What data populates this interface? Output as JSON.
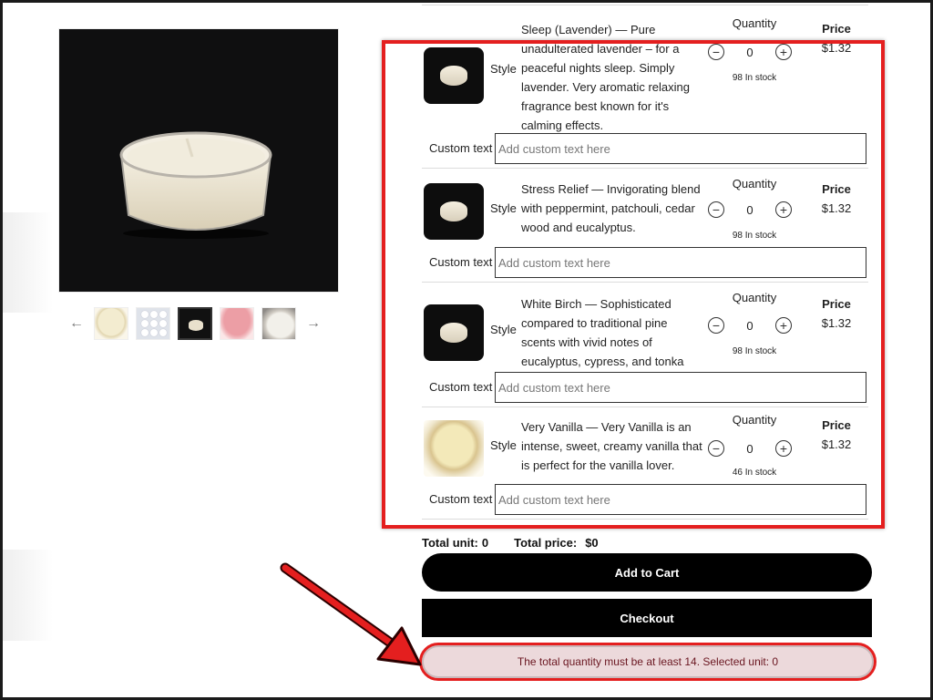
{
  "gallery": {
    "main_image_alt": "White tealight candle on black background",
    "prev_label": "←",
    "next_label": "→",
    "thumbnails": [
      "cream tealight",
      "tealight pack",
      "white tealight on black",
      "pink tealight",
      "white tealight top view"
    ],
    "active_index": 2
  },
  "products": [
    {
      "style_label": "Style",
      "description": "Sleep (Lavender) — Pure unadulterated lavender – for a peaceful nights sleep. Simply lavender. Very aromatic relaxing fragrance best known for it's calming effects.",
      "quantity_label": "Quantity",
      "quantity": "0",
      "stock": "98 In stock",
      "price_label": "Price",
      "price": "$1.32",
      "custom_label": "Custom text",
      "custom_placeholder": "Add custom text here",
      "custom_value": ""
    },
    {
      "style_label": "Style",
      "description": "Stress Relief — Invigorating blend with peppermint, patchouli, cedar wood and eucalyptus.",
      "quantity_label": "Quantity",
      "quantity": "0",
      "stock": "98 In stock",
      "price_label": "Price",
      "price": "$1.32",
      "custom_label": "Custom text",
      "custom_placeholder": "Add custom text here",
      "custom_value": ""
    },
    {
      "style_label": "Style",
      "description": "White Birch — Sophisticated compared to traditional pine scents with vivid notes of eucalyptus, cypress, and tonka bean",
      "quantity_label": "Quantity",
      "quantity": "0",
      "stock": "98 In stock",
      "price_label": "Price",
      "price": "$1.32",
      "custom_label": "Custom text",
      "custom_placeholder": "Add custom text here",
      "custom_value": ""
    },
    {
      "style_label": "Style",
      "description": "Very Vanilla — Very Vanilla is an intense, sweet, creamy vanilla that is perfect for the vanilla lover.",
      "quantity_label": "Quantity",
      "quantity": "0",
      "stock": "46 In stock",
      "price_label": "Price",
      "price": "$1.32",
      "custom_label": "Custom text",
      "custom_placeholder": "Add custom text here",
      "custom_value": ""
    }
  ],
  "summary": {
    "total_unit_label": "Total unit:",
    "total_unit": "0",
    "total_price_label": "Total price:",
    "total_price": "$0"
  },
  "actions": {
    "add_to_cart": "Add to Cart",
    "checkout": "Checkout"
  },
  "alert": {
    "message": "The total quantity must be at least 14. Selected unit: 0"
  },
  "icons": {
    "minus": "−",
    "plus": "+"
  },
  "colors": {
    "highlight": "#e41f1f",
    "alert_bg": "#ecd9db",
    "alert_text": "#6a1620",
    "button_bg": "#000000"
  }
}
